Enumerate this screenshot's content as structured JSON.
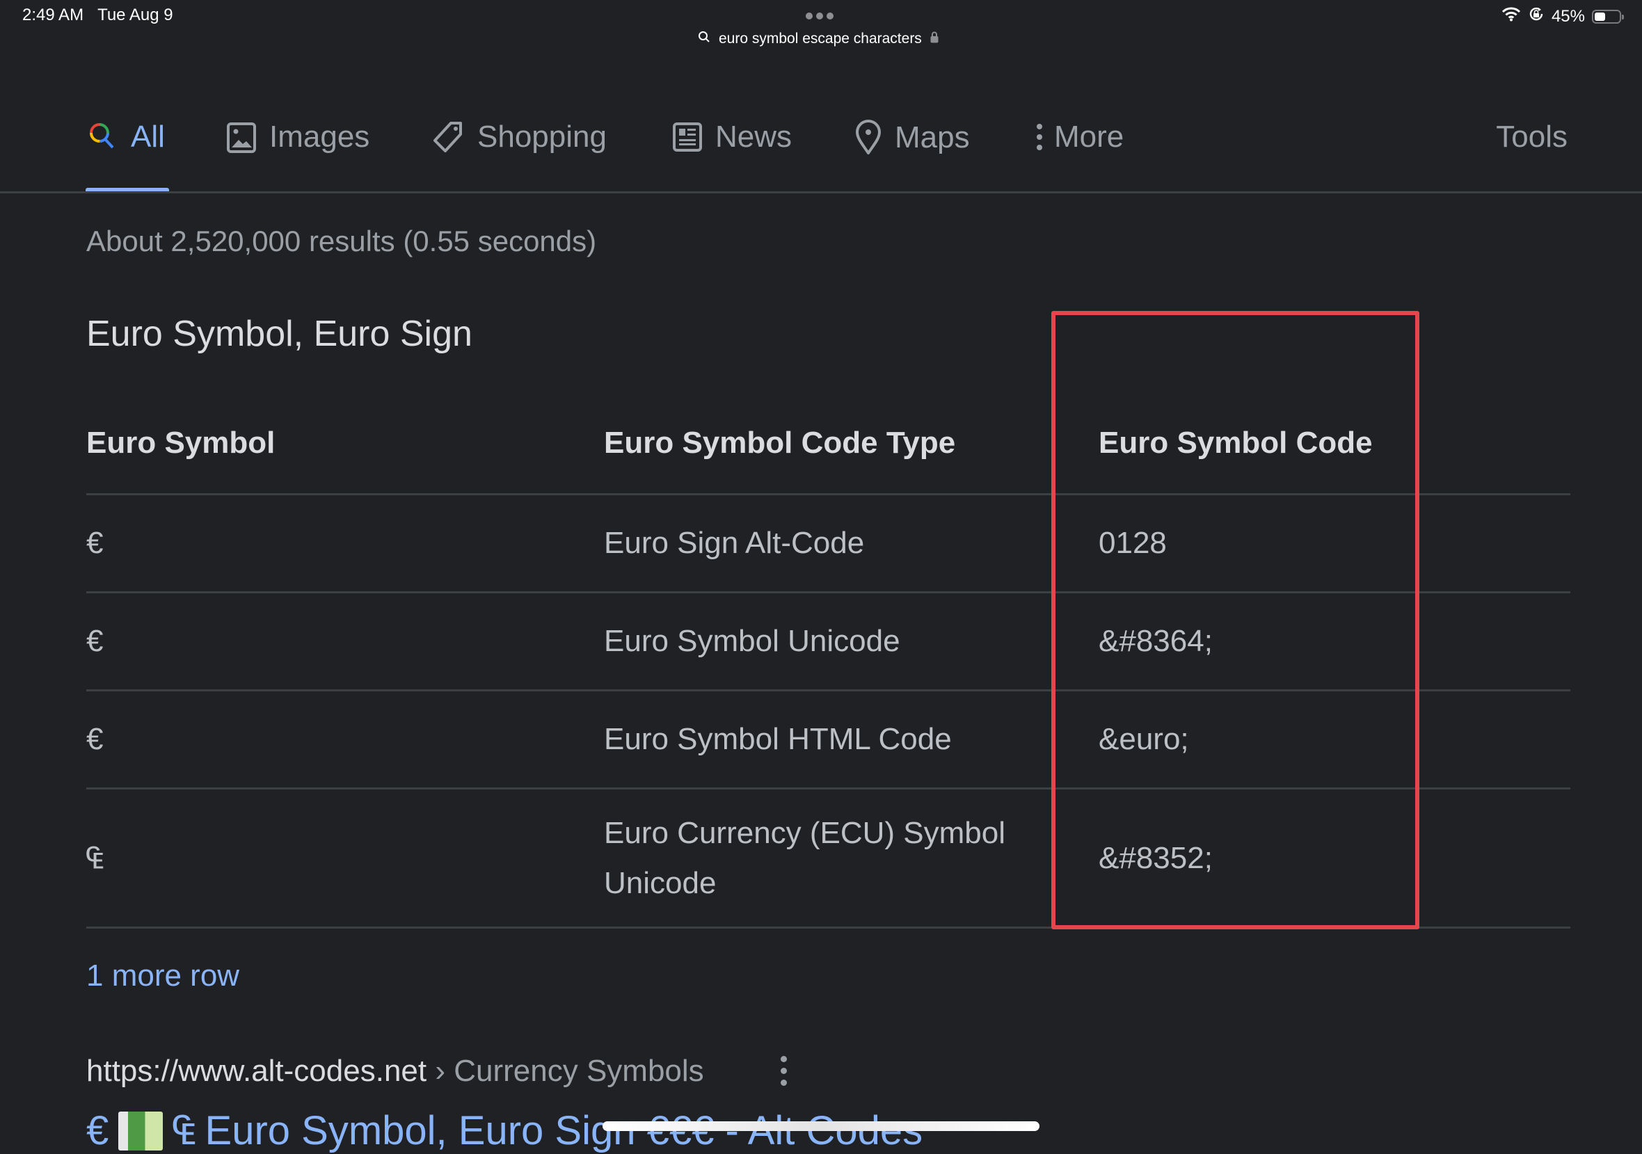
{
  "status_bar": {
    "time": "2:49 AM",
    "date": "Tue Aug 9",
    "battery_percent_label": "45%",
    "battery_level": 0.45,
    "icons": [
      "wifi-icon",
      "orientation-lock-icon",
      "battery-icon"
    ]
  },
  "address_bar": {
    "query": "euro symbol escape characters",
    "icons": [
      "search-icon",
      "lock-icon"
    ]
  },
  "tabs": [
    {
      "label": "All",
      "icon": "google-search-icon",
      "active": true
    },
    {
      "label": "Images",
      "icon": "image-icon",
      "active": false
    },
    {
      "label": "Shopping",
      "icon": "tag-icon",
      "active": false
    },
    {
      "label": "News",
      "icon": "newspaper-icon",
      "active": false
    },
    {
      "label": "Maps",
      "icon": "map-pin-icon",
      "active": false
    },
    {
      "label": "More",
      "icon": "more-vertical-icon",
      "active": false
    }
  ],
  "tools_label": "Tools",
  "result_stats": "About 2,520,000 results (0.55 seconds)",
  "featured_snippet": {
    "title": "Euro Symbol, Euro Sign",
    "columns": [
      "Euro Symbol",
      "Euro Symbol Code Type",
      "Euro Symbol Code"
    ],
    "rows": [
      {
        "symbol": "€",
        "type": "Euro Sign Alt-Code",
        "code": "0128"
      },
      {
        "symbol": "€",
        "type": "Euro Symbol Unicode",
        "code": "&#8364;"
      },
      {
        "symbol": "€",
        "type": "Euro Symbol HTML Code",
        "code": "&euro;"
      },
      {
        "symbol": "₠",
        "type": "Euro Currency (ECU) Symbol Unicode",
        "code": "&#8352;"
      }
    ],
    "more_rows_label": "1 more row",
    "highlighted_column": "Euro Symbol Code",
    "highlight_color": "#e8444c"
  },
  "result": {
    "url": "https://www.alt-codes.net",
    "breadcrumb": "› Currency Symbols",
    "title_prefix_euro": "€",
    "title_prefix_ecu": "₠",
    "title": "Euro Symbol, Euro Sign €€€ - Alt Codes"
  },
  "colors": {
    "background": "#202124",
    "link": "#8ab4f8",
    "muted_text": "#9aa0a6",
    "divider": "#3c4043"
  }
}
